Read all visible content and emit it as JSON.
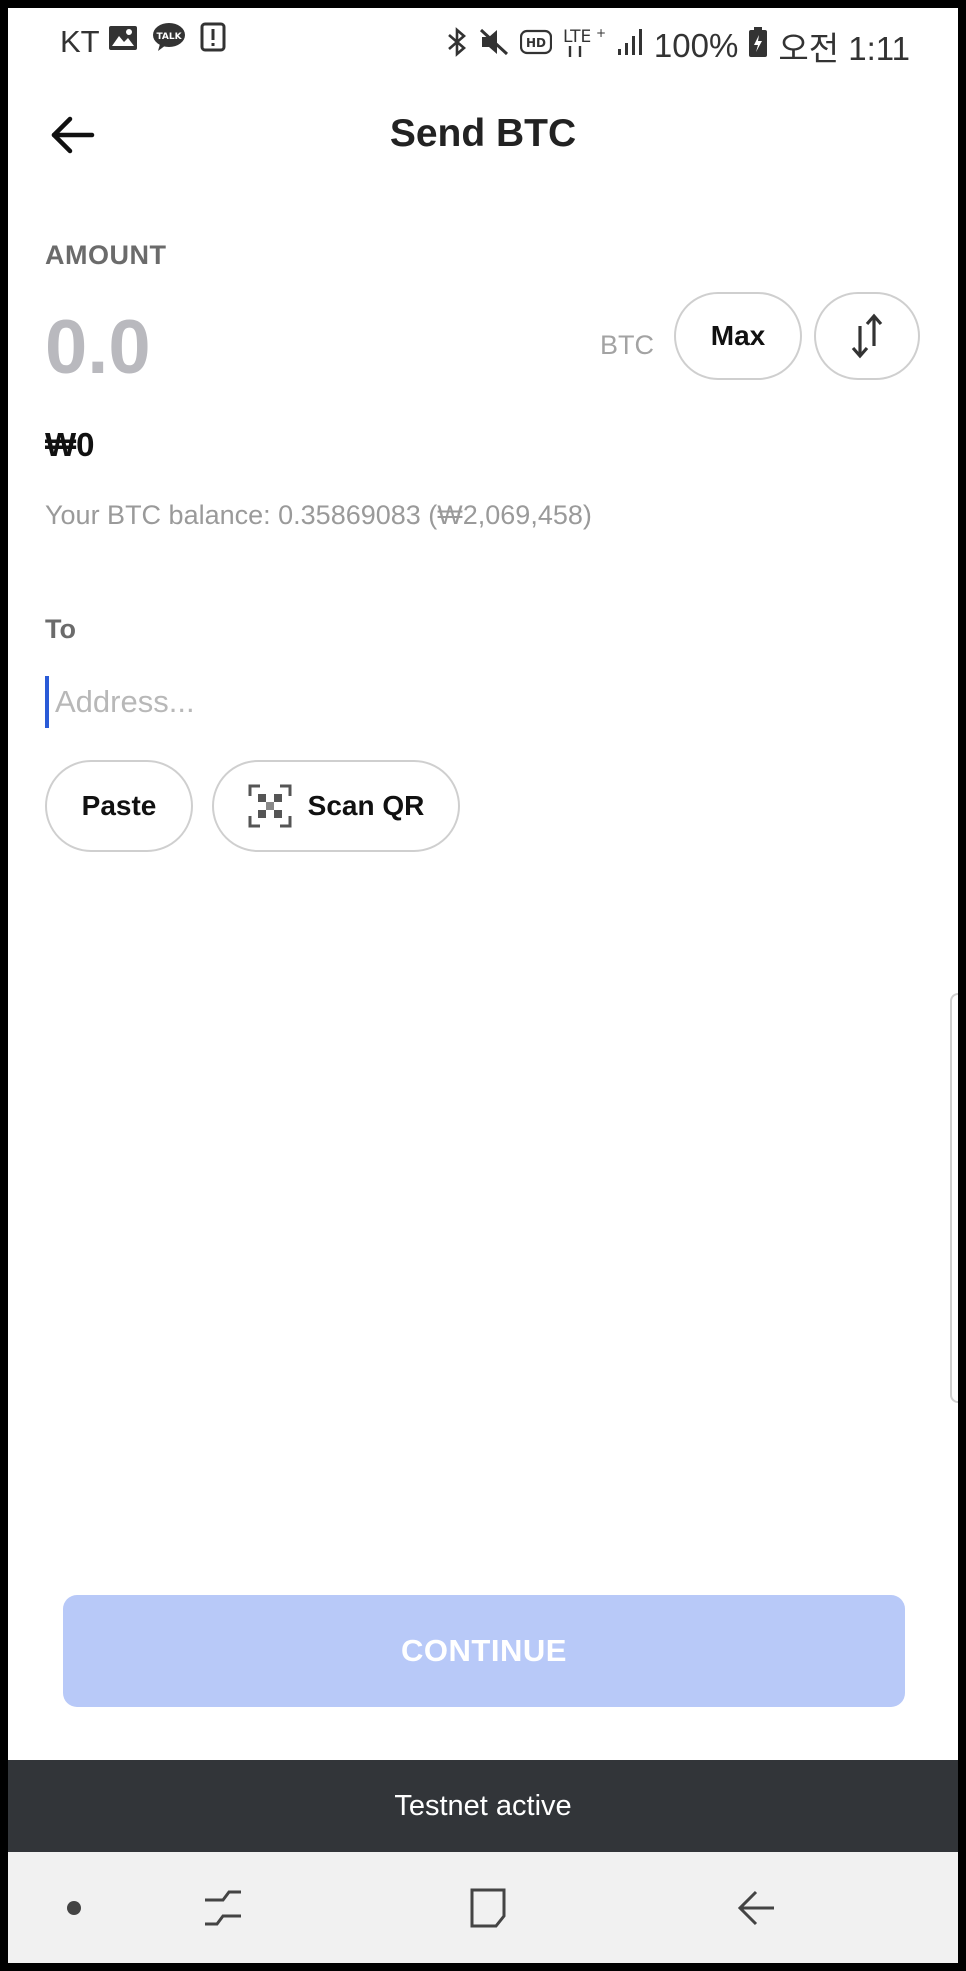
{
  "status_bar": {
    "carrier": "KT",
    "battery_percent": "100%",
    "time": "오전 1:11"
  },
  "header": {
    "title": "Send BTC"
  },
  "amount": {
    "label": "AMOUNT",
    "value": "0.0",
    "unit": "BTC",
    "max_label": "Max",
    "fiat_value": "₩0",
    "balance_text": "Your BTC balance: 0.35869083 (₩2,069,458)"
  },
  "recipient": {
    "label": "To",
    "address_value": "",
    "address_placeholder": "Address...",
    "paste_label": "Paste",
    "scan_qr_label": "Scan QR"
  },
  "continue_label": "CONTINUE",
  "testnet_banner": "Testnet active",
  "colors": {
    "accent_disabled": "#b8c9f8",
    "banner_bg": "#323539",
    "cursor": "#2a5bd7"
  },
  "icons": [
    "back-arrow-icon",
    "swap-arrows-icon",
    "qr-scan-icon",
    "bluetooth-icon",
    "mute-icon",
    "hd-icon",
    "lte-icon",
    "signal-icon",
    "battery-icon",
    "gallery-icon",
    "talk-icon",
    "alert-icon"
  ]
}
